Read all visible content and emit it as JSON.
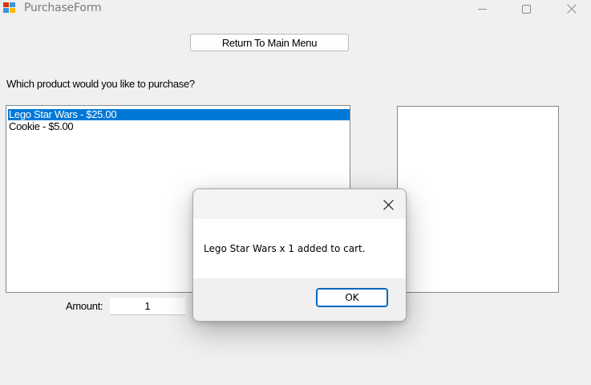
{
  "window": {
    "title": "PurchaseForm",
    "icon": "form-app-icon",
    "controls": [
      "minimize-icon",
      "maximize-icon",
      "close-icon"
    ]
  },
  "form": {
    "menu_button_label": "Return To Main Menu",
    "question": "Which product would you like to purchase?",
    "products": [
      {
        "label": "Lego Star Wars - $25.00",
        "selected": true
      },
      {
        "label": "Cookie - $5.00",
        "selected": false
      }
    ],
    "cart_items": [],
    "amount_label": "Amount:",
    "amount_value": "1"
  },
  "dialog": {
    "message": "Lego Star Wars x 1 added to cart.",
    "ok_label": "OK",
    "close_icon": "close-icon"
  },
  "colors": {
    "selection": "#0078d7",
    "window_background": "#f0f0f0",
    "ok_border": "#0067c0"
  }
}
